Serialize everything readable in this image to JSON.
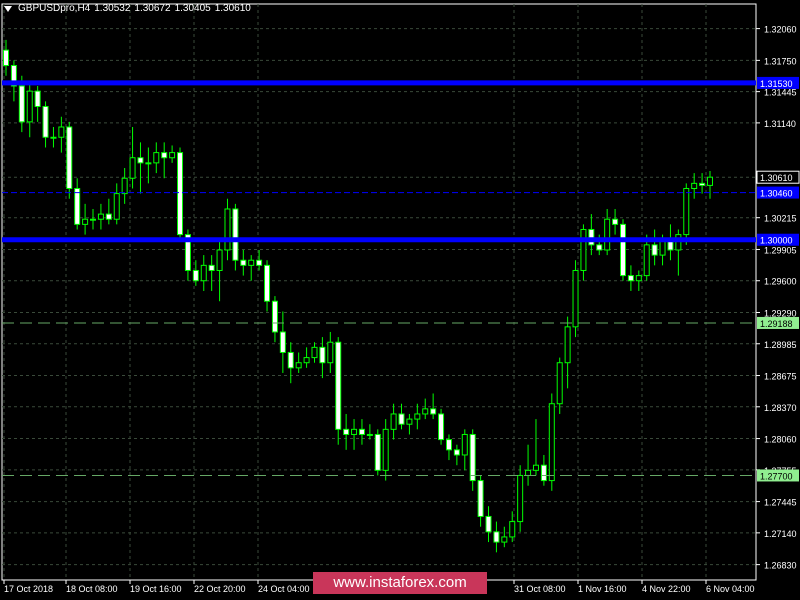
{
  "header": {
    "symbol": "GBPUSDpro,H4",
    "open": "1.30532",
    "high": "1.30672",
    "low": "1.30405",
    "close": "1.30610"
  },
  "watermark": "www.instaforex.com",
  "colors": {
    "background": "#000000",
    "grid": "#3a4a3a",
    "axis": "#ffffff",
    "bull": "#000000",
    "bear": "#ffffff",
    "wick": "#00ff00",
    "level_line": "#0000ff",
    "dashed_line": "#66a866",
    "label_green": "#90ee90"
  },
  "chart_data": {
    "type": "candlestick",
    "ylim": [
      1.2668,
      1.323
    ],
    "y_ticks": [
      "1.32060",
      "1.31750",
      "1.31445",
      "1.31140",
      "1.30610",
      "1.30215",
      "1.29905",
      "1.29600",
      "1.29290",
      "1.28985",
      "1.28675",
      "1.28370",
      "1.28060",
      "1.27755",
      "1.27445",
      "1.27140",
      "1.26830"
    ],
    "x_ticks": [
      "17 Oct 2018",
      "18 Oct 08:00",
      "19 Oct 16:00",
      "22 Oct 20:00",
      "24 Oct 04:00",
      "31 Oct 08:00",
      "1 Nov 16:00",
      "4 Nov 22:00",
      "6 Nov 04:00"
    ],
    "current_price": "1.30610",
    "levels": [
      {
        "price": 1.3153,
        "label": "1.31530",
        "style": "thick"
      },
      {
        "price": 1.3046,
        "label": "1.30460",
        "style": "thin"
      },
      {
        "price": 1.3,
        "label": "1.30000",
        "style": "thick"
      },
      {
        "price": 1.29188,
        "label": "1.29188",
        "style": "dashed"
      },
      {
        "price": 1.277,
        "label": "1.27700",
        "style": "dashed"
      }
    ],
    "candles": [
      [
        1.3185,
        1.3195,
        1.316,
        1.317
      ],
      [
        1.317,
        1.3175,
        1.3135,
        1.315
      ],
      [
        1.315,
        1.316,
        1.3105,
        1.3115
      ],
      [
        1.3115,
        1.3155,
        1.31,
        1.3145
      ],
      [
        1.3145,
        1.315,
        1.3115,
        1.313
      ],
      [
        1.313,
        1.3135,
        1.309,
        1.31
      ],
      [
        1.31,
        1.311,
        1.309,
        1.31
      ],
      [
        1.31,
        1.312,
        1.3085,
        1.311
      ],
      [
        1.311,
        1.3115,
        1.304,
        1.305
      ],
      [
        1.305,
        1.306,
        1.301,
        1.3015
      ],
      [
        1.3015,
        1.3035,
        1.3005,
        1.302
      ],
      [
        1.302,
        1.303,
        1.301,
        1.302
      ],
      [
        1.302,
        1.3035,
        1.301,
        1.3025
      ],
      [
        1.3025,
        1.304,
        1.3015,
        1.302
      ],
      [
        1.302,
        1.3055,
        1.3015,
        1.3045
      ],
      [
        1.3045,
        1.307,
        1.3035,
        1.306
      ],
      [
        1.306,
        1.311,
        1.305,
        1.308
      ],
      [
        1.308,
        1.3095,
        1.3045,
        1.3075
      ],
      [
        1.3075,
        1.309,
        1.3055,
        1.3075
      ],
      [
        1.3075,
        1.3095,
        1.3065,
        1.3085
      ],
      [
        1.3085,
        1.3095,
        1.306,
        1.308
      ],
      [
        1.308,
        1.3092,
        1.3075,
        1.3085
      ],
      [
        1.3085,
        1.309,
        1.3,
        1.3005
      ],
      [
        1.3005,
        1.301,
        1.296,
        1.297
      ],
      [
        1.297,
        1.298,
        1.2955,
        1.296
      ],
      [
        1.296,
        1.2985,
        1.295,
        1.2975
      ],
      [
        1.2975,
        1.2985,
        1.295,
        1.297
      ],
      [
        1.297,
        1.3,
        1.294,
        1.299
      ],
      [
        1.299,
        1.304,
        1.298,
        1.303
      ],
      [
        1.303,
        1.3035,
        1.297,
        1.298
      ],
      [
        1.298,
        1.299,
        1.2965,
        1.2975
      ],
      [
        1.2975,
        1.2985,
        1.296,
        1.298
      ],
      [
        1.298,
        1.299,
        1.297,
        1.2975
      ],
      [
        1.2975,
        1.298,
        1.293,
        1.294
      ],
      [
        1.294,
        1.2945,
        1.29,
        1.291
      ],
      [
        1.291,
        1.293,
        1.287,
        1.289
      ],
      [
        1.289,
        1.29,
        1.286,
        1.2875
      ],
      [
        1.2875,
        1.289,
        1.287,
        1.288
      ],
      [
        1.288,
        1.2895,
        1.2875,
        1.2885
      ],
      [
        1.2885,
        1.29,
        1.288,
        1.2895
      ],
      [
        1.2895,
        1.2905,
        1.2865,
        1.288
      ],
      [
        1.288,
        1.291,
        1.287,
        1.29
      ],
      [
        1.29,
        1.2905,
        1.28,
        1.2815
      ],
      [
        1.2815,
        1.283,
        1.2795,
        1.281
      ],
      [
        1.281,
        1.2825,
        1.2795,
        1.2815
      ],
      [
        1.2815,
        1.2825,
        1.28,
        1.281
      ],
      [
        1.281,
        1.282,
        1.2805,
        1.281
      ],
      [
        1.281,
        1.2815,
        1.277,
        1.2775
      ],
      [
        1.2775,
        1.2825,
        1.2765,
        1.2815
      ],
      [
        1.2815,
        1.284,
        1.2805,
        1.283
      ],
      [
        1.283,
        1.284,
        1.2815,
        1.282
      ],
      [
        1.282,
        1.283,
        1.281,
        1.2825
      ],
      [
        1.2825,
        1.284,
        1.2815,
        1.283
      ],
      [
        1.283,
        1.2845,
        1.2825,
        1.2835
      ],
      [
        1.2835,
        1.285,
        1.2825,
        1.283
      ],
      [
        1.283,
        1.2835,
        1.28,
        1.2805
      ],
      [
        1.2805,
        1.281,
        1.2785,
        1.2795
      ],
      [
        1.2795,
        1.28,
        1.278,
        1.279
      ],
      [
        1.279,
        1.2815,
        1.2775,
        1.281
      ],
      [
        1.281,
        1.2815,
        1.2755,
        1.2765
      ],
      [
        1.2765,
        1.277,
        1.272,
        1.273
      ],
      [
        1.273,
        1.274,
        1.2705,
        1.2715
      ],
      [
        1.2715,
        1.2725,
        1.2695,
        1.2705
      ],
      [
        1.2705,
        1.272,
        1.27,
        1.271
      ],
      [
        1.271,
        1.2735,
        1.2705,
        1.2725
      ],
      [
        1.2725,
        1.278,
        1.2715,
        1.277
      ],
      [
        1.277,
        1.28,
        1.276,
        1.2775
      ],
      [
        1.2775,
        1.2825,
        1.277,
        1.278
      ],
      [
        1.278,
        1.279,
        1.276,
        1.2765
      ],
      [
        1.2765,
        1.285,
        1.2755,
        1.284
      ],
      [
        1.284,
        1.2885,
        1.283,
        1.288
      ],
      [
        1.288,
        1.2925,
        1.2855,
        1.2915
      ],
      [
        1.2915,
        1.298,
        1.2905,
        1.297
      ],
      [
        1.297,
        1.3015,
        1.296,
        1.301
      ],
      [
        1.301,
        1.3025,
        1.2985,
        1.2995
      ],
      [
        1.2995,
        1.3005,
        1.2985,
        1.299
      ],
      [
        1.299,
        1.303,
        1.2985,
        1.302
      ],
      [
        1.302,
        1.303,
        1.3005,
        1.3015
      ],
      [
        1.3015,
        1.302,
        1.296,
        1.2965
      ],
      [
        1.2965,
        1.2975,
        1.295,
        1.296
      ],
      [
        1.296,
        1.297,
        1.295,
        1.2965
      ],
      [
        1.2965,
        1.3005,
        1.296,
        1.2995
      ],
      [
        1.2995,
        1.301,
        1.2975,
        1.2985
      ],
      [
        1.2985,
        1.3005,
        1.2975,
        1.3
      ],
      [
        1.3,
        1.3015,
        1.298,
        1.299
      ],
      [
        1.299,
        1.301,
        1.2965,
        1.3005
      ],
      [
        1.3005,
        1.3055,
        1.2995,
        1.305
      ],
      [
        1.305,
        1.3065,
        1.304,
        1.3055
      ],
      [
        1.3055,
        1.3065,
        1.3045,
        1.3053
      ],
      [
        1.3053,
        1.3067,
        1.304,
        1.3061
      ]
    ]
  }
}
